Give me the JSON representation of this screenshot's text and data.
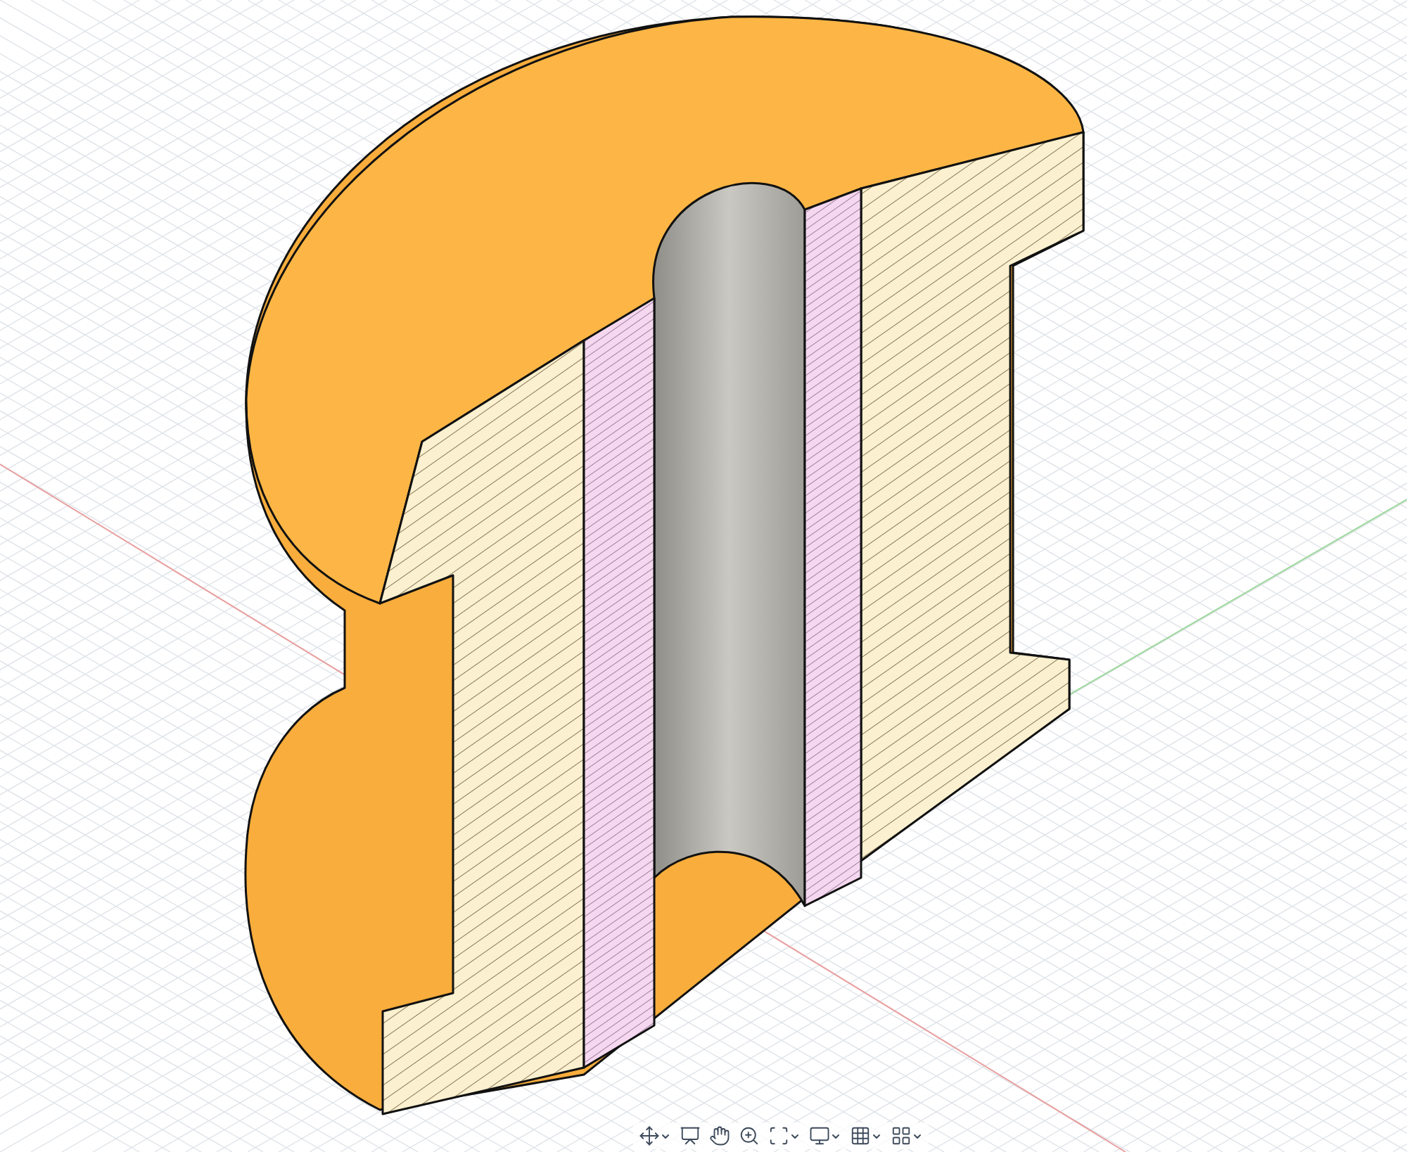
{
  "viewport": {
    "toolbar": [
      {
        "kind": "orbit",
        "dropdown": true
      },
      {
        "kind": "look",
        "dropdown": false
      },
      {
        "kind": "pan",
        "dropdown": false
      },
      {
        "kind": "zoom",
        "dropdown": false
      },
      {
        "kind": "fit",
        "dropdown": true
      },
      {
        "kind": "display",
        "dropdown": true
      },
      {
        "kind": "grid",
        "dropdown": true
      },
      {
        "kind": "viewports",
        "dropdown": true
      }
    ]
  }
}
